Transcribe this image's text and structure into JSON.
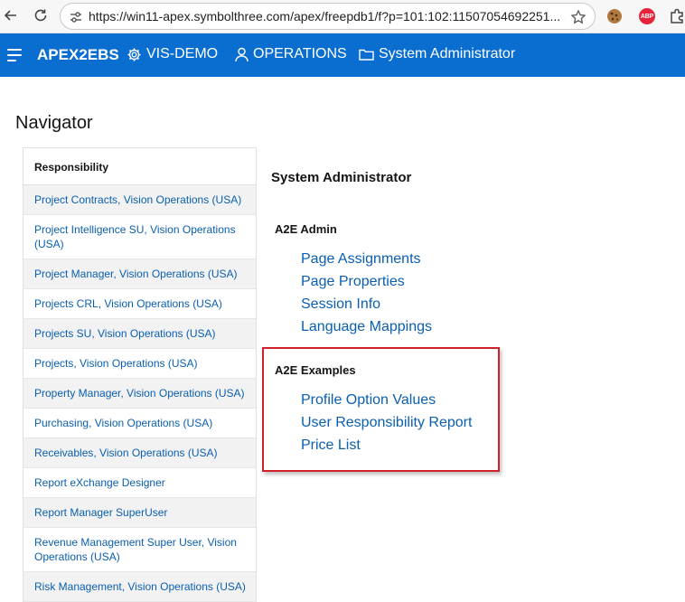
{
  "browser": {
    "url": "https://win11-apex.symbolthree.com/apex/freepdb1/f?p=101:102:11507054692251..."
  },
  "app_header": {
    "title": "APEX2EBS",
    "items": [
      {
        "label": "VIS-DEMO",
        "icon": "gear-icon"
      },
      {
        "label": "OPERATIONS",
        "icon": "user-icon"
      },
      {
        "label": "System Administrator",
        "icon": "folder-icon"
      }
    ]
  },
  "page": {
    "title": "Navigator"
  },
  "responsibility": {
    "header": "Responsibility",
    "rows": [
      "Project Contracts, Vision Operations (USA)",
      "Project Intelligence SU, Vision Operations (USA)",
      "Project Manager, Vision Operations (USA)",
      "Projects CRL, Vision Operations (USA)",
      "Projects SU, Vision Operations (USA)",
      "Projects, Vision Operations (USA)",
      "Property Manager, Vision Operations (USA)",
      "Purchasing, Vision Operations (USA)",
      "Receivables, Vision Operations (USA)",
      "Report eXchange Designer",
      "Report Manager SuperUser",
      "Revenue Management Super User, Vision Operations (USA)",
      "Risk Management, Vision Operations (USA)"
    ]
  },
  "menu": {
    "title": "System Administrator",
    "groups": [
      {
        "title": "A2E Admin",
        "links": [
          "Page Assignments",
          "Page Properties",
          "Session Info",
          "Language Mappings"
        ]
      },
      {
        "title": "A2E Examples",
        "links": [
          "Profile Option Values",
          "User Responsibility Report",
          "Price List"
        ]
      }
    ]
  },
  "colors": {
    "header_bg": "#0a6ed1",
    "link": "#0a5fb0",
    "highlight": "#d0202a"
  }
}
